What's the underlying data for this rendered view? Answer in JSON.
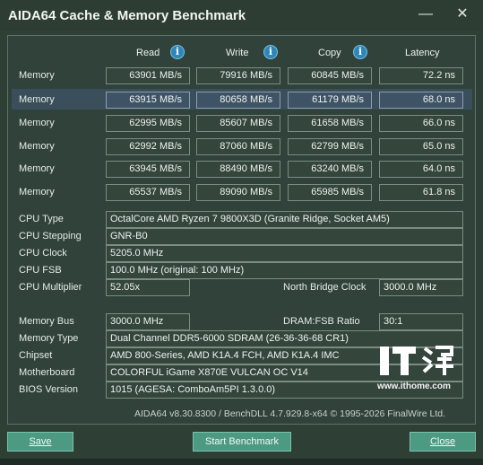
{
  "window": {
    "title": "AIDA64 Cache & Memory Benchmark",
    "minimize": "—",
    "close": "✕"
  },
  "columns": {
    "read": "Read",
    "write": "Write",
    "copy": "Copy",
    "latency": "Latency"
  },
  "bench_rows": [
    {
      "label": "Memory",
      "read": "63901 MB/s",
      "write": "79916 MB/s",
      "copy": "60845 MB/s",
      "latency": "72.2 ns"
    },
    {
      "label": "Memory",
      "read": "63915 MB/s",
      "write": "80658 MB/s",
      "copy": "61179 MB/s",
      "latency": "68.0 ns"
    },
    {
      "label": "Memory",
      "read": "62995 MB/s",
      "write": "85607 MB/s",
      "copy": "61658 MB/s",
      "latency": "66.0 ns"
    },
    {
      "label": "Memory",
      "read": "62992 MB/s",
      "write": "87060 MB/s",
      "copy": "62799 MB/s",
      "latency": "65.0 ns"
    },
    {
      "label": "Memory",
      "read": "63945 MB/s",
      "write": "88490 MB/s",
      "copy": "63240 MB/s",
      "latency": "64.0 ns"
    },
    {
      "label": "Memory",
      "read": "65537 MB/s",
      "write": "89090 MB/s",
      "copy": "65985 MB/s",
      "latency": "61.8 ns"
    }
  ],
  "cpu": {
    "type_label": "CPU Type",
    "type": "OctalCore AMD Ryzen 7 9800X3D  (Granite Ridge, Socket AM5)",
    "stepping_label": "CPU Stepping",
    "stepping": "GNR-B0",
    "clock_label": "CPU Clock",
    "clock": "5205.0 MHz",
    "fsb_label": "CPU FSB",
    "fsb": "100.0 MHz  (original: 100 MHz)",
    "multiplier_label": "CPU Multiplier",
    "multiplier": "52.05x",
    "nb_clock_label": "North Bridge Clock",
    "nb_clock": "3000.0 MHz"
  },
  "memory": {
    "bus_label": "Memory Bus",
    "bus": "3000.0 MHz",
    "ratio_label": "DRAM:FSB Ratio",
    "ratio": "30:1",
    "type_label": "Memory Type",
    "type": "Dual Channel DDR5-6000 SDRAM  (26-36-36-68 CR1)",
    "chipset_label": "Chipset",
    "chipset": "AMD 800-Series, AMD K1A.4 FCH, AMD K1A.4 IMC",
    "motherboard_label": "Motherboard",
    "motherboard": "COLORFUL iGame X870E VULCAN OC V14",
    "bios_label": "BIOS Version",
    "bios": "1015  (AGESA: ComboAm5PI 1.3.0.0)"
  },
  "footer": "AIDA64 v8.30.8300 / BenchDLL 4.7.929.8-x64  © 1995-2026 FinalWire Ltd.",
  "buttons": {
    "save": "Save",
    "start": "Start Benchmark",
    "close": "Close"
  },
  "watermark": {
    "url": "www.ithome.com"
  }
}
